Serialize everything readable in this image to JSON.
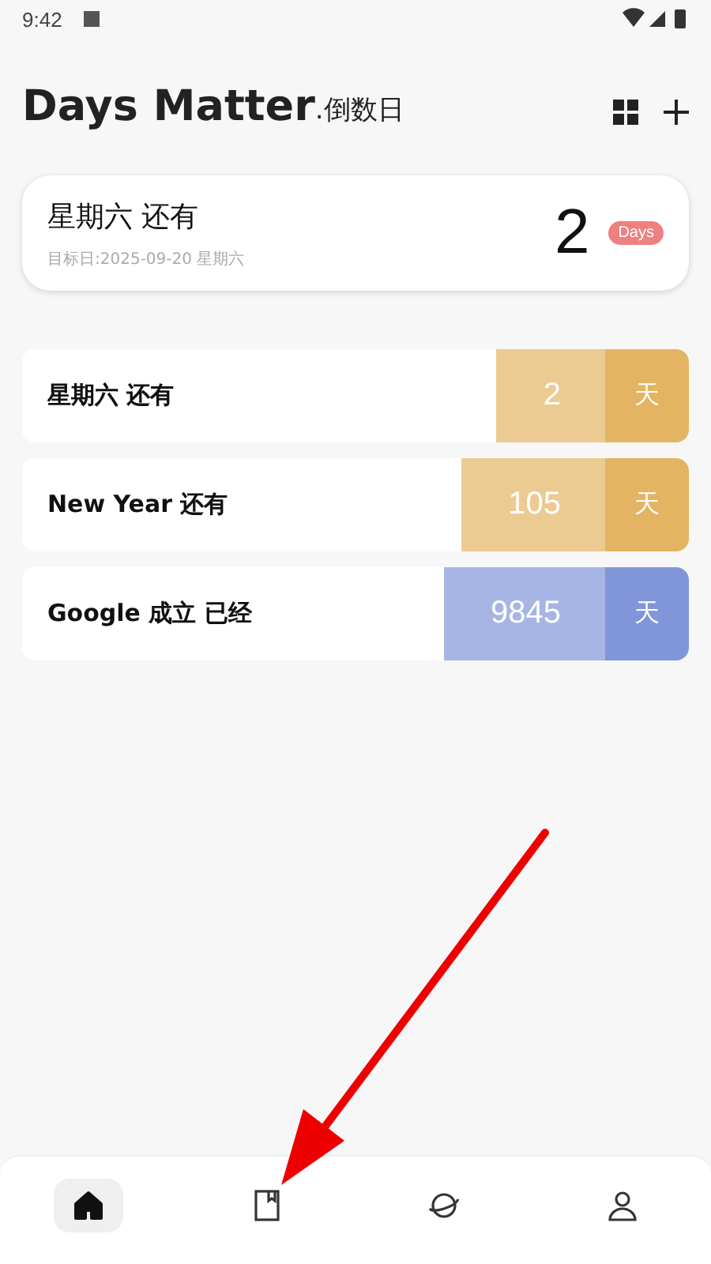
{
  "status_bar": {
    "time": "9:42"
  },
  "header": {
    "title": "Days Matter",
    "subtitle": ".倒数日"
  },
  "featured": {
    "title": "星期六 还有",
    "target": "目标日:2025-09-20 星期六",
    "count": "2",
    "badge": "Days"
  },
  "events": [
    {
      "title": "星期六 还有",
      "count": "2",
      "unit": "天",
      "color": "#e3b562"
    },
    {
      "title": "New Year 还有",
      "count": "105",
      "unit": "天",
      "color": "#e3b562"
    },
    {
      "title": "Google 成立 已经",
      "count": "9845",
      "unit": "天",
      "color": "#8196d8"
    }
  ],
  "nav": [
    {
      "kind": "home",
      "selected": true
    },
    {
      "kind": "book",
      "selected": false
    },
    {
      "kind": "planet",
      "selected": false
    },
    {
      "kind": "person",
      "selected": false
    }
  ]
}
